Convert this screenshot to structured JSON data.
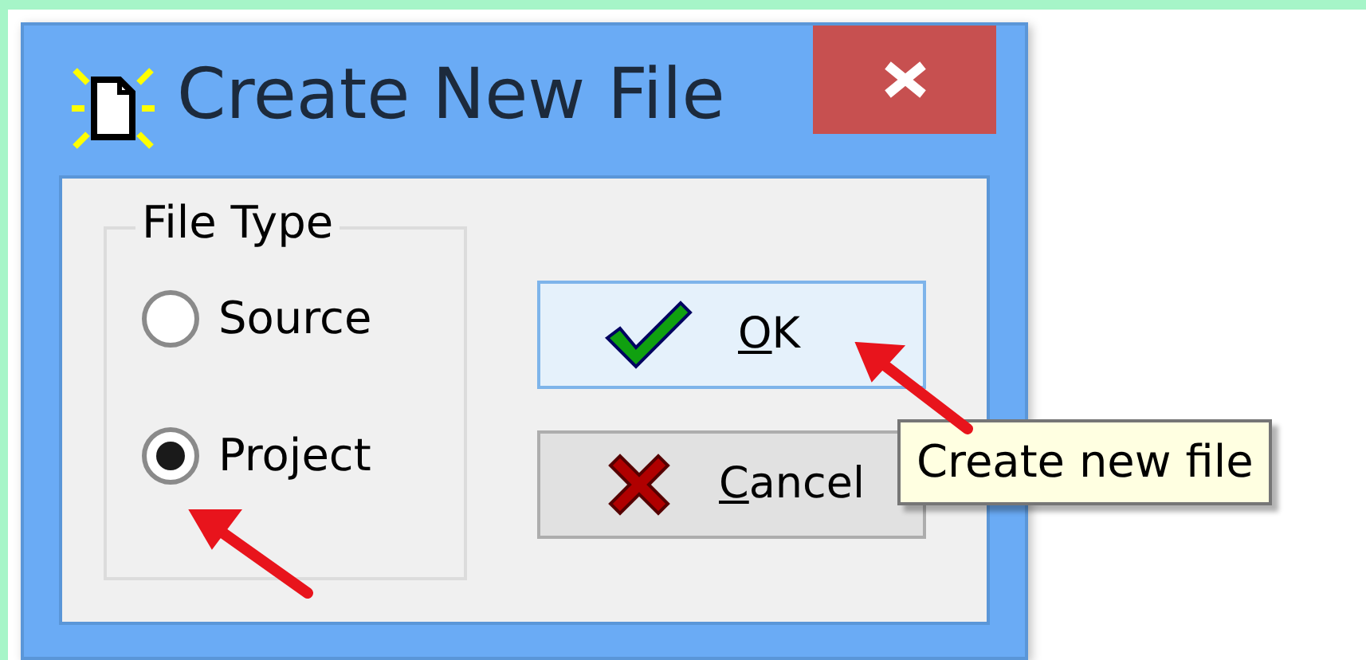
{
  "window": {
    "title": "Create New File"
  },
  "group": {
    "title": "File Type",
    "options": [
      {
        "label": "Source",
        "selected": false
      },
      {
        "label": "Project",
        "selected": true
      }
    ]
  },
  "buttons": [
    {
      "label": "OK",
      "kind": "ok",
      "highlighted": true
    },
    {
      "label": "Cancel",
      "kind": "cancel",
      "highlighted": false
    }
  ],
  "tooltip": {
    "text": "Create new file"
  }
}
